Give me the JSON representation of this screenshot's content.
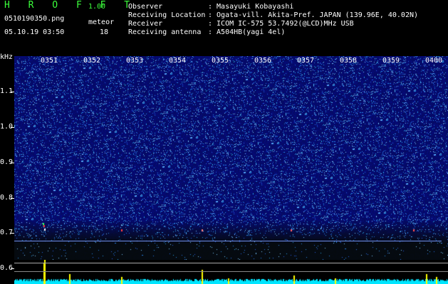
{
  "app": {
    "title": "H R O F F T",
    "version": "1.00"
  },
  "file": {
    "name": "0510190350.png",
    "date_time": "05.10.19 03:50"
  },
  "meteor": {
    "label": "meteor",
    "count": "18"
  },
  "info": {
    "observer_label": "Observer",
    "observer_value": ": Masayuki Kobayashi",
    "location_label": "Receiving Location",
    "location_value": ": Ogata-vill. Akita-Pref. JAPAN (139.96E, 40.02N)",
    "receiver_label": "Receiver",
    "receiver_value": ": ICOM IC-575 53.7492(@LCD)MHz USB",
    "antenna_label": "Receiving antenna",
    "antenna_value": ": A504HB(yagi 4el)"
  },
  "axis": {
    "unit": "kHz",
    "freq_labels": [
      "1.1",
      "1.0",
      "0.9",
      "0.8",
      "0.7",
      "0.6"
    ],
    "time_labels": [
      "0351",
      "0352",
      "0353",
      "0354",
      "0355",
      "0356",
      "0357",
      "0358",
      "0359",
      "0400"
    ]
  },
  "colors": {
    "background": "#000000",
    "header_green": "#3cff3c",
    "spectrogram_base": "#0a0f78",
    "meteor_bar": "#ffff00",
    "noise_floor": "#00e5ff"
  }
}
